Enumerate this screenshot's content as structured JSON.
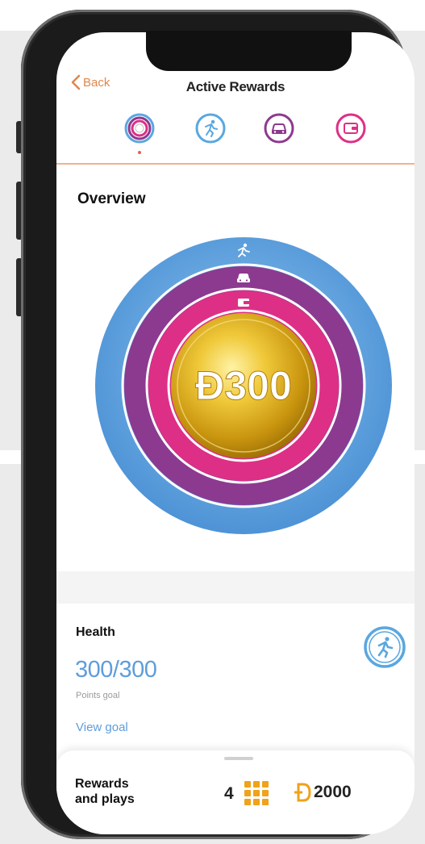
{
  "header": {
    "back_label": "Back",
    "title": "Active Rewards"
  },
  "tabs": [
    {
      "icon": "rings-icon",
      "active": true
    },
    {
      "icon": "running-icon",
      "active": false
    },
    {
      "icon": "car-icon",
      "active": false
    },
    {
      "icon": "wallet-icon",
      "active": false
    }
  ],
  "overview": {
    "heading": "Overview",
    "coin_value": "Ð300",
    "ring_icons": [
      "running-icon",
      "car-icon",
      "wallet-icon"
    ],
    "colors": {
      "outer": "#5aa7e0",
      "middle": "#8c3a8f",
      "inner": "#de2f86",
      "coin": "#d4a017"
    }
  },
  "health": {
    "label": "Health",
    "score": "300/300",
    "caption": "Points goal",
    "link": "View goal",
    "icon": "running-icon"
  },
  "bottom": {
    "label": "Rewards\nand plays",
    "plays_count": "4",
    "plays_icon": "grid-icon",
    "coins": "2000",
    "coins_icon": "dollar-coin-icon"
  }
}
